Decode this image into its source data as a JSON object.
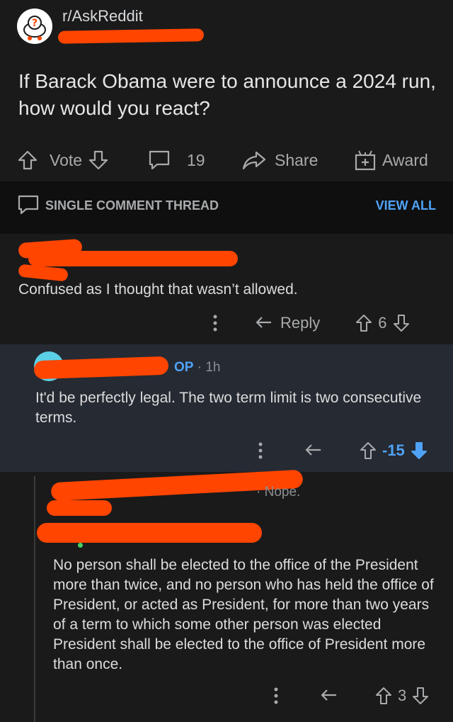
{
  "post": {
    "subreddit": "r/AskReddit",
    "title": "If Barack Obama were to announce a 2024 run, how would you react?",
    "actions": {
      "vote": "Vote",
      "comments": "19",
      "share": "Share",
      "award": "Award"
    }
  },
  "thread": {
    "label": "SINGLE COMMENT THREAD",
    "view_all": "VIEW ALL"
  },
  "comments": [
    {
      "text": "Confused as I thought that wasn’t allowed.",
      "reply": "Reply",
      "score": "6"
    },
    {
      "tag": "OP",
      "time": "· 1h",
      "text": "It'd be perfectly legal. The two term limit is two consecutive terms.",
      "score": "-15"
    },
    {
      "snippet": "· Nope.",
      "text": "No person shall be elected to the office of the President more than twice, and no person who has held the office of President, or acted as President, for more than two years of a term to which some other person was elected President shall be elected to the office of President more than once.",
      "score": "3"
    }
  ],
  "colors": {
    "accent": "#4fa3f7",
    "redaction": "#ff4500",
    "op_bg": "#252a33",
    "downvote": "#4fa3f7"
  }
}
